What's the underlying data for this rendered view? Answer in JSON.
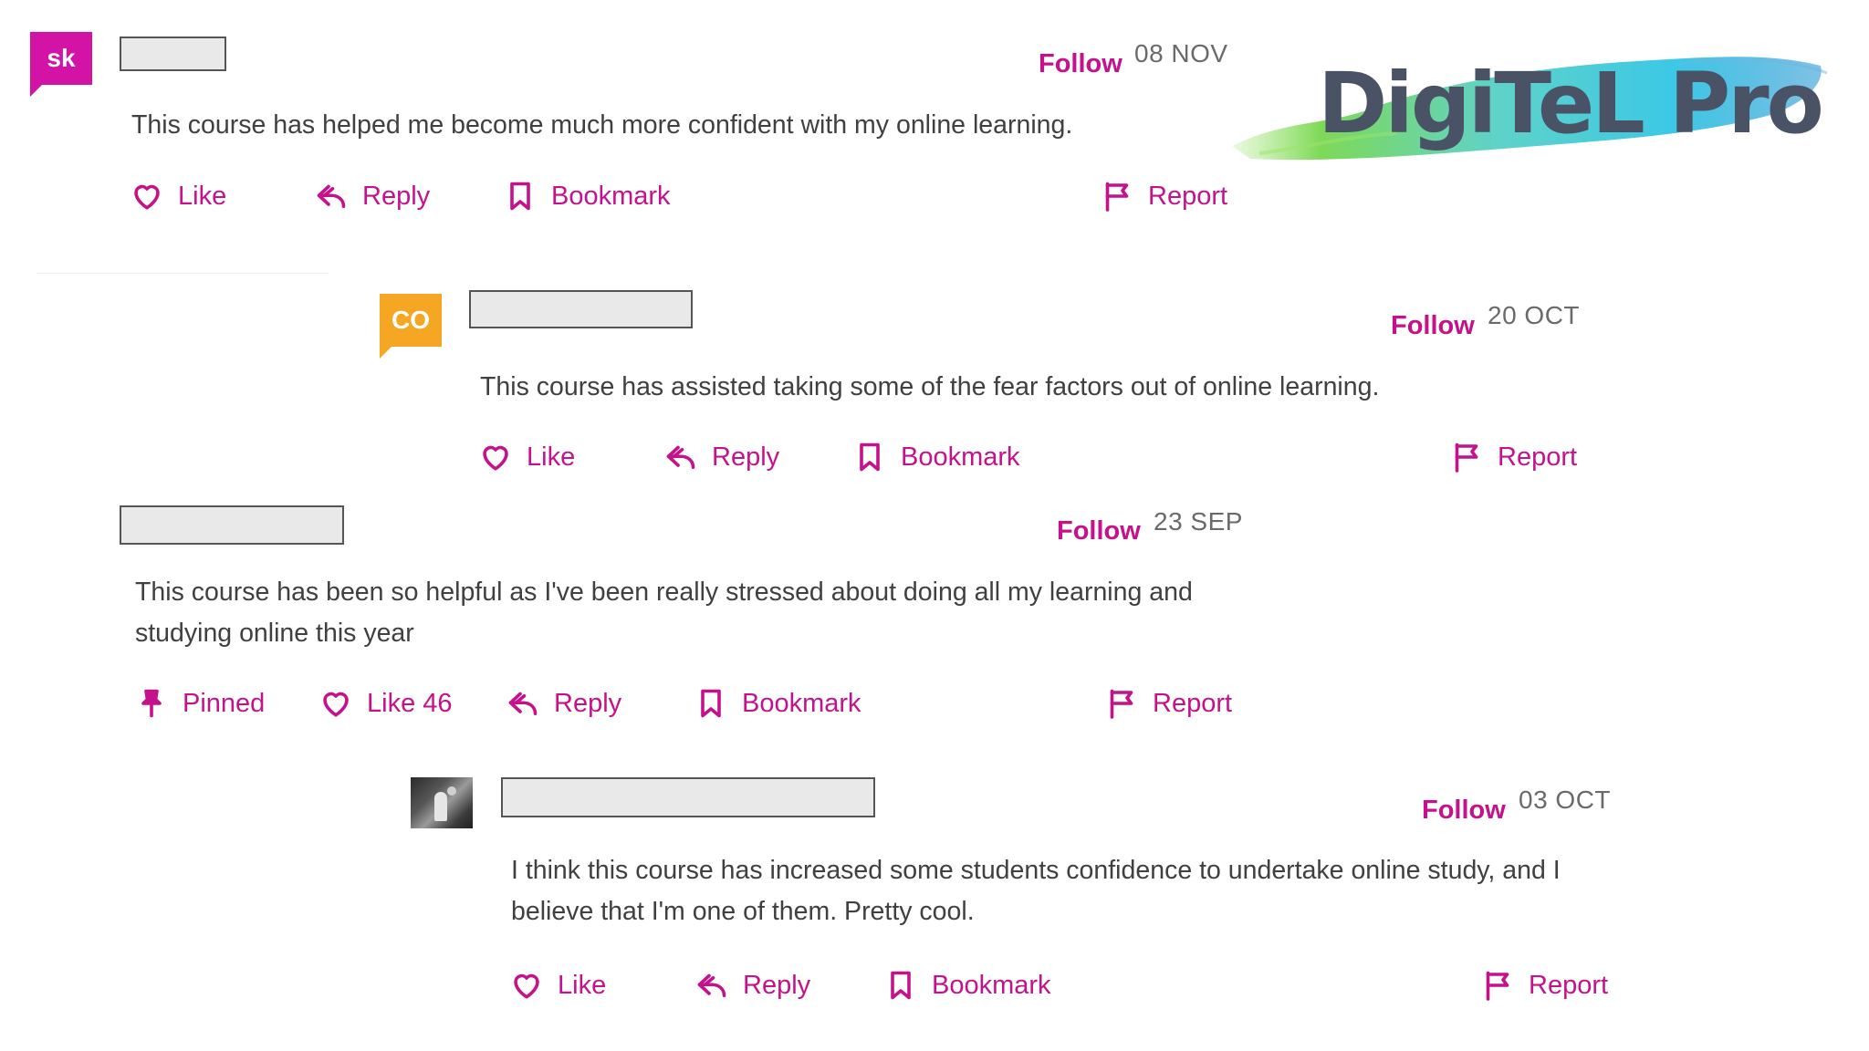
{
  "logo": {
    "text": "DigiTeL Pro",
    "colors": [
      "#7ed957",
      "#3cc8e6",
      "#2a9ad4"
    ]
  },
  "actions": {
    "follow": "Follow",
    "like": "Like",
    "reply": "Reply",
    "bookmark": "Bookmark",
    "report": "Report",
    "pinned": "Pinned"
  },
  "comments": [
    {
      "avatar": {
        "initials": "sk",
        "color": "#d313a6"
      },
      "date": "08 NOV",
      "text": "This course has helped me become much more confident with my online learning."
    },
    {
      "avatar": {
        "initials": "CO",
        "color": "#f5a623"
      },
      "date": "20 OCT",
      "text": "This course has assisted taking some of the fear factors out of online learning."
    },
    {
      "date": "23 SEP",
      "text_lines": [
        "This course has been so helpful as I've been really stressed about doing all my learning and",
        "studying online this year"
      ],
      "like_label": "Like 46"
    },
    {
      "avatar": {
        "type": "photo"
      },
      "date": "03 OCT",
      "text_lines": [
        "I think this course has increased some students confidence to undertake online study, and I",
        "believe that I'm one of them. Pretty cool."
      ]
    }
  ],
  "accent_color": "#c4128c"
}
